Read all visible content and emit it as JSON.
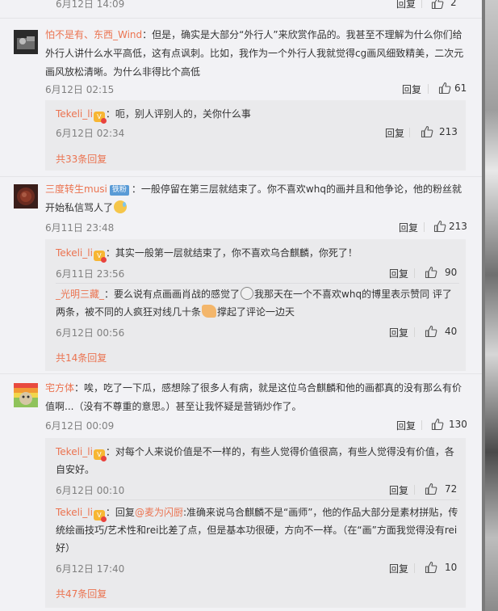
{
  "top_row": {
    "time": "6月12日 14:09",
    "reply_label": "回复",
    "like_count": "2"
  },
  "comments": [
    {
      "user": "怕不是有、东西_Wind",
      "text": "：但是，确实是大部分“外行人”来欣赏作品的。我甚至不理解为什么你们给外行人讲什么水平高低，这有点讽刺。比如，我作为一个外行人我就觉得cg画风细致精美，二次元画风放松清晰。为什么非得比个高低",
      "time": "6月12日 02:15",
      "reply_label": "回复",
      "like_count": "61",
      "replies": [
        {
          "user": "Tekeli_li",
          "text": "：呃，别人评别人的，关你什么事",
          "time": "6月12日 02:34",
          "reply_label": "回复",
          "like_count": "213"
        }
      ],
      "more": "共33条回复"
    },
    {
      "user": "三度转生musi",
      "badge": "铁粉",
      "text": "：一般停留在第三层就结束了。你不喜欢whq的画并且和他争论，他的粉丝就开始私信骂人了",
      "time": "6月11日 23:48",
      "reply_label": "回复",
      "like_count": "213",
      "replies": [
        {
          "user": "Tekeli_li",
          "text": "：其实一般第一层就结束了，你不喜欢乌合麒麟，你死了！",
          "time": "6月11日 23:56",
          "reply_label": "回复",
          "like_count": "90"
        },
        {
          "user": "_光明三藏_",
          "text_a": "：要么说有点画画肖战的感觉了",
          "text_b": "我那天在一个不喜欢whq的博里表示赞同 评了两条，被不同的人疯狂对线几十条",
          "text_c": "撑起了评论一边天",
          "time": "6月12日 00:56",
          "reply_label": "回复",
          "like_count": "40"
        }
      ],
      "more": "共14条回复"
    },
    {
      "user": "宅方体",
      "text": "：唉，吃了一下瓜，感想除了很多人有病，就是这位乌合麒麟和他的画都真的没有那么有价值啊...（没有不尊重的意思。）甚至让我怀疑是营销炒作了。",
      "time": "6月12日 00:09",
      "reply_label": "回复",
      "like_count": "130",
      "replies": [
        {
          "user": "Tekeli_li",
          "text": "：对每个人来说价值是不一样的，有些人觉得价值很高，有些人觉得没有价值，各自安好。",
          "time": "6月12日 00:10",
          "reply_label": "回复",
          "like_count": "72"
        },
        {
          "user": "Tekeli_li",
          "reply_prefix": "：回复",
          "mention": "@麦为闪厨",
          "text": ":准确来说乌合麒麟不是“画师”，他的作品大部分是素材拼贴，传统绘画技巧/艺术性和rei比差了点，但是基本功很硬，方向不一样。（在“画”方面我觉得没有rei好）",
          "time": "6月12日 17:40",
          "reply_label": "回复",
          "like_count": "10"
        }
      ],
      "more": "共47条回复"
    }
  ],
  "icons": {
    "like": "thumbs-up-icon"
  },
  "colors": {
    "accent": "#eb7350",
    "meta": "#808080",
    "reply_box": "#eaeaec",
    "page": "#f2f2f5"
  }
}
